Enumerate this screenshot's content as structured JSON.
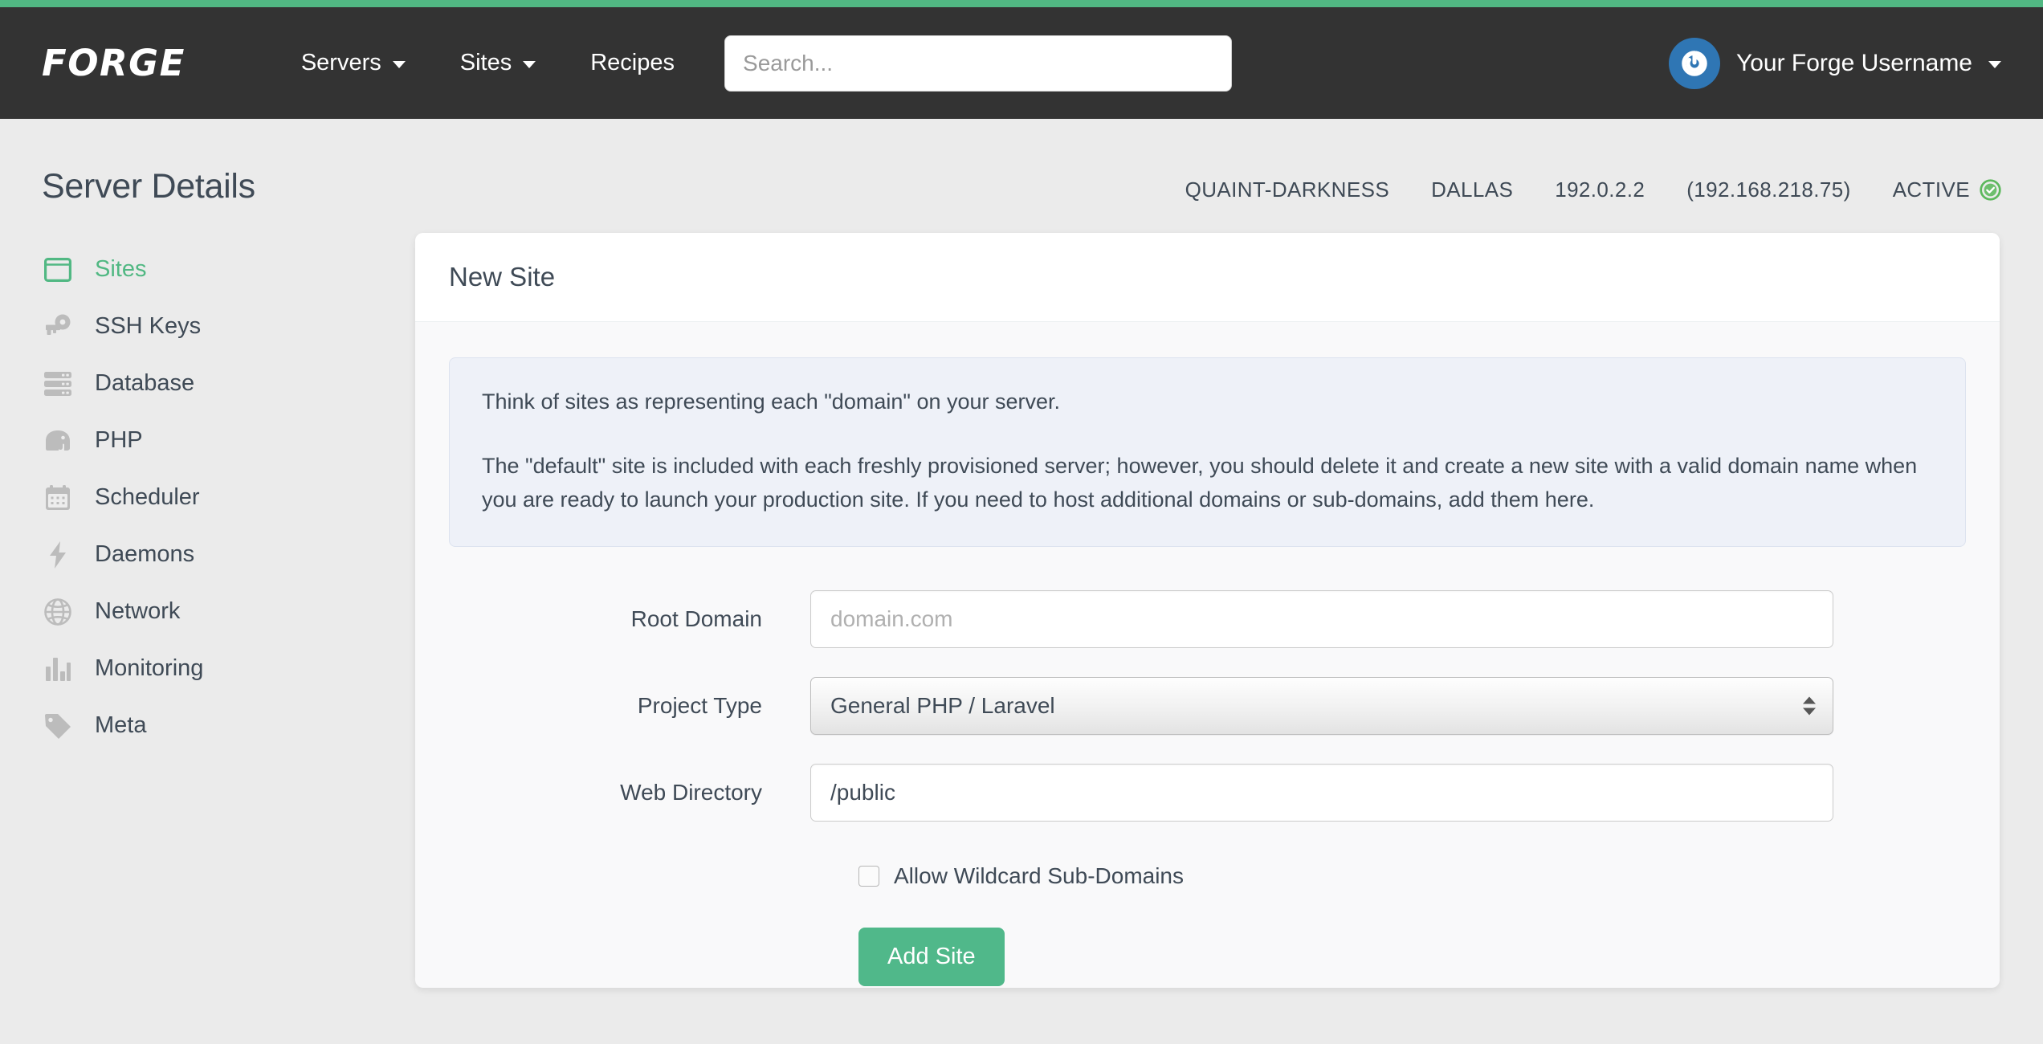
{
  "theme": {
    "accent_green": "#51b883",
    "navbar_bg": "#333333",
    "page_bg": "#ebebeb",
    "text_dark": "#3f4a56",
    "avatar_blue": "#2f76b4",
    "alert_bg": "#eef1f8"
  },
  "navbar": {
    "logo": "FORGE",
    "links": [
      {
        "label": "Servers",
        "has_caret": true,
        "icon": "chevron-down-icon"
      },
      {
        "label": "Sites",
        "has_caret": true,
        "icon": "chevron-down-icon"
      },
      {
        "label": "Recipes",
        "has_caret": false,
        "icon": ""
      }
    ],
    "search": {
      "value": "",
      "placeholder": "Search..."
    },
    "user": {
      "name": "Your Forge Username",
      "avatar_icon": "power-swirl-avatar-icon",
      "caret_icon": "chevron-down-icon"
    }
  },
  "page_header": {
    "title": "Server Details",
    "meta": [
      "QUAINT-DARKNESS",
      "DALLAS",
      "192.0.2.2",
      "(192.168.218.75)"
    ],
    "status": {
      "label": "ACTIVE",
      "icon": "check-circle-icon",
      "color": "#5cb85c"
    }
  },
  "sidebar": {
    "items": [
      {
        "label": "Sites",
        "icon": "browser-window-icon",
        "active": true
      },
      {
        "label": "SSH Keys",
        "icon": "key-icon",
        "active": false
      },
      {
        "label": "Database",
        "icon": "server-rack-icon",
        "active": false
      },
      {
        "label": "PHP",
        "icon": "elephant-icon",
        "active": false
      },
      {
        "label": "Scheduler",
        "icon": "calendar-icon",
        "active": false
      },
      {
        "label": "Daemons",
        "icon": "lightning-bolt-icon",
        "active": false
      },
      {
        "label": "Network",
        "icon": "globe-icon",
        "active": false
      },
      {
        "label": "Monitoring",
        "icon": "bar-chart-icon",
        "active": false
      },
      {
        "label": "Meta",
        "icon": "tag-icon",
        "active": false
      }
    ]
  },
  "card": {
    "title": "New Site",
    "alert": {
      "paragraph_1": "Think of sites as representing each \"domain\" on your server.",
      "paragraph_2": "The \"default\" site is included with each freshly provisioned server; however, you should delete it and create a new site with a valid domain name when you are ready to launch your production site. If you need to host additional domains or sub-domains, add them here."
    },
    "form": {
      "root_domain": {
        "label": "Root Domain",
        "value": "",
        "placeholder": "domain.com"
      },
      "project_type": {
        "label": "Project Type",
        "selected": "General PHP / Laravel",
        "stepper_icon": "updown-stepper-icon"
      },
      "web_directory": {
        "label": "Web Directory",
        "value": "/public",
        "placeholder": ""
      },
      "wildcard": {
        "label": "Allow Wildcard Sub-Domains",
        "checked": false
      },
      "submit": {
        "label": "Add Site"
      }
    }
  }
}
